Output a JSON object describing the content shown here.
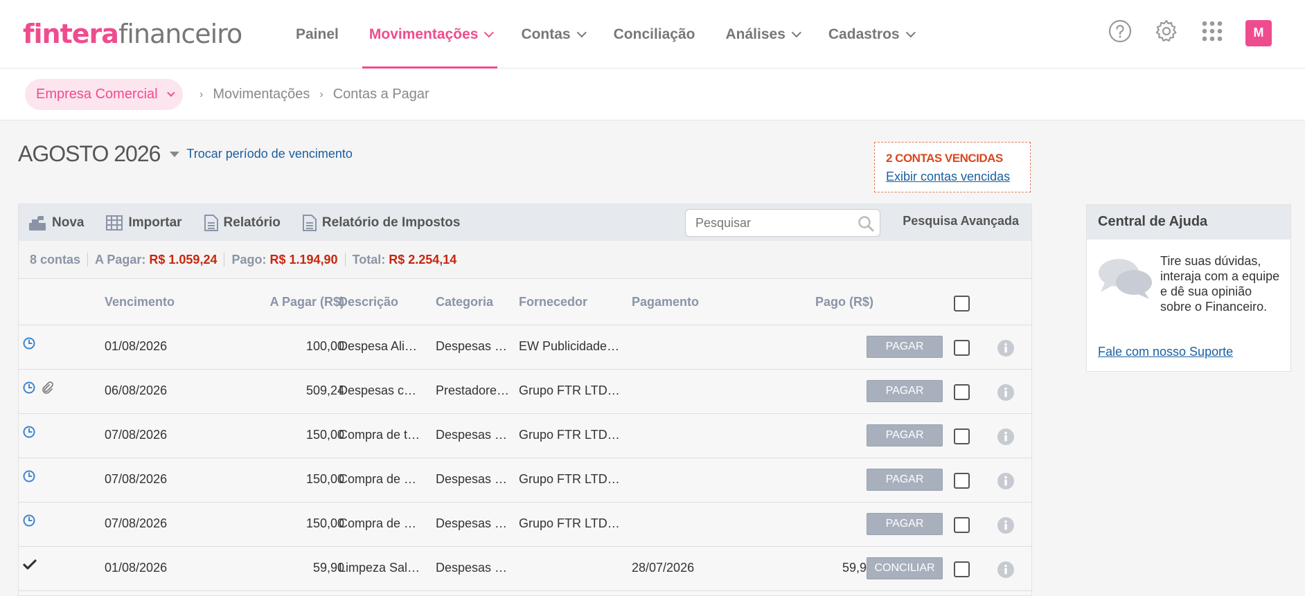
{
  "brand": {
    "part1": "fintera",
    "part2": "financeiro",
    "accent": "#ef4c8f"
  },
  "nav": [
    {
      "label": "Painel",
      "dropdown": false,
      "active": false
    },
    {
      "label": "Movimentações",
      "dropdown": true,
      "active": true
    },
    {
      "label": "Contas",
      "dropdown": true,
      "active": false
    },
    {
      "label": "Conciliação",
      "dropdown": false,
      "active": false
    },
    {
      "label": "Análises",
      "dropdown": true,
      "active": false
    },
    {
      "label": "Cadastros",
      "dropdown": true,
      "active": false
    }
  ],
  "user": {
    "initial": "M"
  },
  "breadcrumb": {
    "company": "Empresa Comercial",
    "items": [
      "Movimentações",
      "Contas a Pagar"
    ]
  },
  "period": {
    "label": "AGOSTO 2026",
    "change_link": "Trocar período de vencimento"
  },
  "overdue": {
    "title": "2 CONTAS VENCIDAS",
    "link": "Exibir contas vencidas"
  },
  "toolbar": {
    "new": "Nova",
    "import": "Importar",
    "report": "Relatório",
    "tax_report": "Relatório de Impostos",
    "search_placeholder": "Pesquisar",
    "advanced": "Pesquisa Avançada"
  },
  "summary": {
    "count": "8 contas",
    "to_pay_label": "A Pagar:",
    "to_pay_value": "R$ 1.059,24",
    "paid_label": "Pago:",
    "paid_value": "R$ 1.194,90",
    "total_label": "Total:",
    "total_value": "R$ 2.254,14"
  },
  "table": {
    "headers": {
      "due": "Vencimento",
      "amount": "A Pagar (R$)",
      "desc": "Descrição",
      "category": "Categoria",
      "supplier": "Fornecedor",
      "payment": "Pagamento",
      "paid": "Pago (R$)"
    },
    "rows": [
      {
        "status": "clock",
        "attach": false,
        "due": "01/08/2026",
        "amount": "100,00",
        "desc": "Despesa Ali…",
        "category": "Despesas …",
        "supplier": "EW Publicidade…",
        "payment": "",
        "paid": "",
        "action": "PAGAR"
      },
      {
        "status": "clock",
        "attach": true,
        "due": "06/08/2026",
        "amount": "509,24",
        "desc": "Despesas c…",
        "category": "Prestadore…",
        "supplier": "Grupo FTR LTD…",
        "payment": "",
        "paid": "",
        "action": "PAGAR"
      },
      {
        "status": "clock",
        "attach": false,
        "due": "07/08/2026",
        "amount": "150,00",
        "desc": "Compra de t…",
        "category": "Despesas …",
        "supplier": "Grupo FTR LTD…",
        "payment": "",
        "paid": "",
        "action": "PAGAR"
      },
      {
        "status": "clock",
        "attach": false,
        "due": "07/08/2026",
        "amount": "150,00",
        "desc": "Compra de …",
        "category": "Despesas …",
        "supplier": "Grupo FTR LTD…",
        "payment": "",
        "paid": "",
        "action": "PAGAR"
      },
      {
        "status": "clock",
        "attach": false,
        "due": "07/08/2026",
        "amount": "150,00",
        "desc": "Compra de …",
        "category": "Despesas …",
        "supplier": "Grupo FTR LTD…",
        "payment": "",
        "paid": "",
        "action": "PAGAR"
      },
      {
        "status": "check",
        "attach": false,
        "due": "01/08/2026",
        "amount": "59,90",
        "desc": "Limpeza Sal…",
        "category": "Despesas …",
        "supplier": "",
        "payment": "28/07/2026",
        "paid": "59,90",
        "action": "CONCILIAR"
      }
    ]
  },
  "help": {
    "title": "Central de Ajuda",
    "text": "Tire suas dúvidas, interaja com a equipe e dê sua opinião sobre o Financeiro.",
    "link": "Fale com nosso Suporte"
  }
}
